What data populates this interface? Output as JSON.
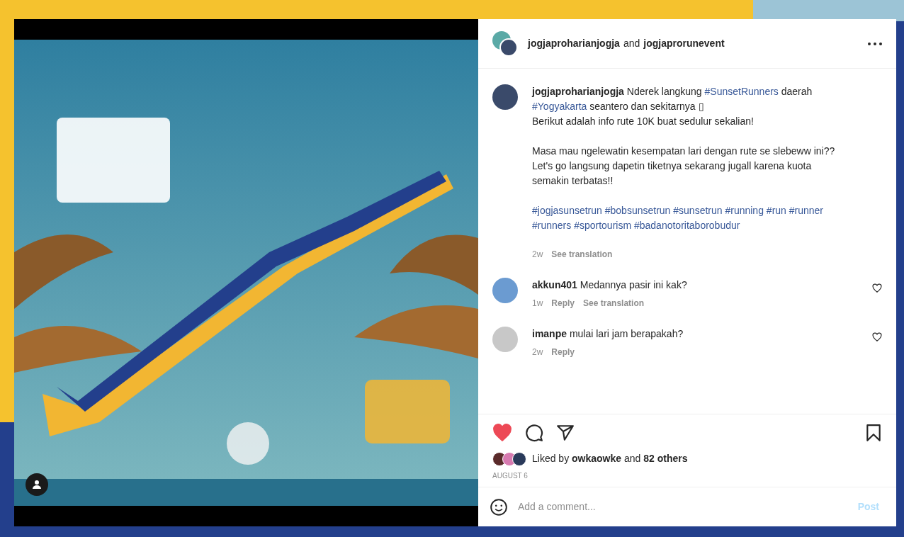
{
  "post": {
    "header": {
      "author": "jogjaproharianjogja",
      "joiner": "and",
      "coauthor": "jogjaprorunevent"
    },
    "caption": {
      "author": "jogjaproharianjogja",
      "paragraphs": [
        [
          {
            "kind": "text",
            "text": "Nderek langkung "
          },
          {
            "kind": "tag",
            "text": "#SunsetRunners"
          },
          {
            "kind": "text",
            "text": " daerah "
          },
          {
            "kind": "tag",
            "text": "#Yogyakarta"
          },
          {
            "kind": "text",
            "text": " seantero dan sekitarnya ▯"
          },
          {
            "kind": "break"
          },
          {
            "kind": "text",
            "text": "Berikut adalah info rute 10K buat sedulur sekalian!"
          }
        ],
        [
          {
            "kind": "text",
            "text": "Masa mau ngelewatin kesempatan lari dengan rute se slebeww ini??"
          },
          {
            "kind": "break"
          },
          {
            "kind": "text",
            "text": "Let's go langsung dapetin tiketnya sekarang jugall karena kuota semakin terbatas!!"
          }
        ],
        [
          {
            "kind": "tag",
            "text": "#jogjasunsetrun"
          },
          {
            "kind": "tag",
            "text": "#bobsunsetrun"
          },
          {
            "kind": "tag",
            "text": "#sunsetrun"
          },
          {
            "kind": "tag",
            "text": "#running"
          },
          {
            "kind": "tag",
            "text": "#run"
          },
          {
            "kind": "tag",
            "text": "#runner"
          },
          {
            "kind": "tag",
            "text": "#runners"
          },
          {
            "kind": "tag",
            "text": "#sportourism"
          },
          {
            "kind": "tag",
            "text": "#badanotoritaborobudur"
          }
        ]
      ],
      "age": "2w",
      "translate": "See translation"
    },
    "comments": [
      {
        "user": "akkun401",
        "text": "Medannya pasir ini kak?",
        "age": "1w",
        "reply": "Reply",
        "translate": "See translation",
        "liked": false
      },
      {
        "user": "imanpe",
        "text": "mulai lari jam berapakah?",
        "age": "2w",
        "reply": "Reply",
        "liked": false
      }
    ],
    "liked": true,
    "saved": false,
    "likes": {
      "prefix": "Liked by",
      "user": "owkaowke",
      "joiner": "and",
      "count": "82 others"
    },
    "date": "AUGUST 6",
    "composer": {
      "placeholder": "Add a comment...",
      "submit": "Post",
      "submit_disabled": true
    }
  }
}
